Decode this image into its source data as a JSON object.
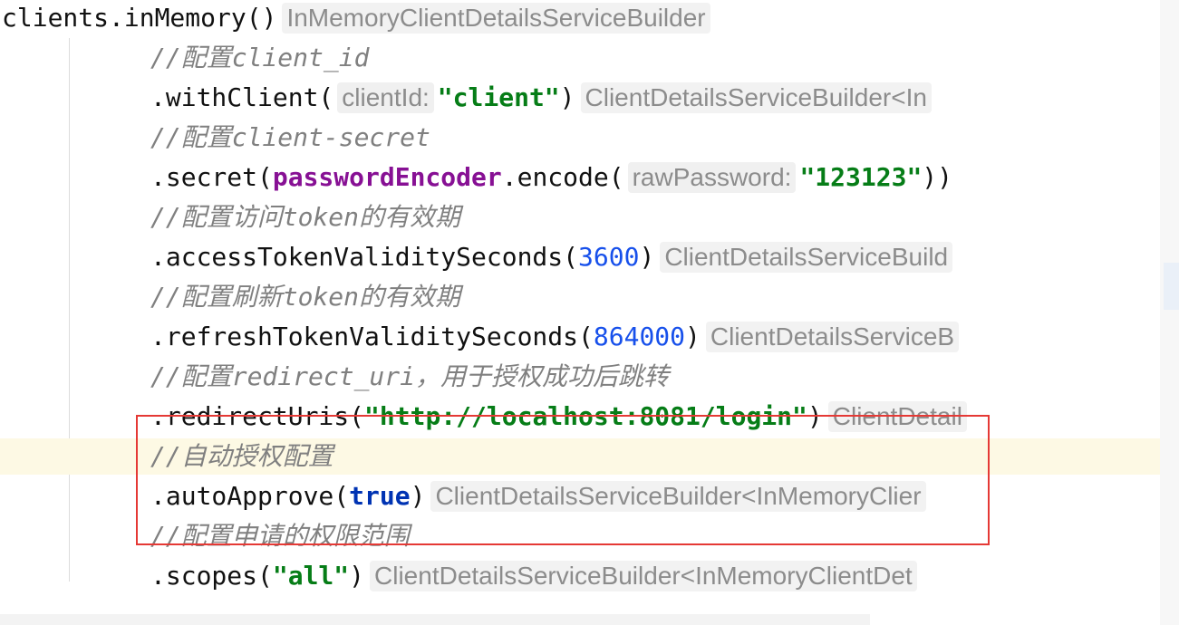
{
  "lines": [
    {
      "code": "clients.inMemory()",
      "hint": "InMemoryClientDetailsServiceBuilder"
    },
    {
      "comment": "//配置client_id"
    },
    {
      "pre": ".withClient(",
      "param": "clientId:",
      "arg": "\"client\"",
      "post": ")",
      "hint": "ClientDetailsServiceBuilder<In"
    },
    {
      "comment": "//配置client-secret"
    },
    {
      "pre": ".secret(",
      "field": "passwordEncoder",
      "mid": ".encode(",
      "param": "rawPassword:",
      "arg": "\"123123\"",
      "post": "))"
    },
    {
      "comment": "//配置访问token的有效期"
    },
    {
      "pre": ".accessTokenValiditySeconds(",
      "arg": "3600",
      "post": ")",
      "hint": "ClientDetailsServiceBuild"
    },
    {
      "comment": "//配置刷新token的有效期"
    },
    {
      "pre": ".refreshTokenValiditySeconds(",
      "arg": "864000",
      "post": ")",
      "hint": "ClientDetailsServiceB"
    },
    {
      "comment": "//配置redirect_uri，用于授权成功后跳转"
    },
    {
      "pre": ".redirectUris(",
      "arg": "\"http://localhost:8081/login\"",
      "post": ")",
      "hint": "ClientDetail"
    },
    {
      "comment": "//自动授权配置"
    },
    {
      "pre": ".autoApprove(",
      "arg": "true",
      "post": ")",
      "hint": "ClientDetailsServiceBuilder<InMemoryClier"
    },
    {
      "comment": "//配置申请的权限范围"
    },
    {
      "pre": ".scopes(",
      "arg": "\"all\"",
      "post": ")",
      "hint": "ClientDetailsServiceBuilder<InMemoryClientDet"
    }
  ],
  "colors": {
    "string": "#067d17",
    "number": "#1750eb",
    "keyword": "#0033b3",
    "field": "#871094",
    "comment": "#808080",
    "hint": "#8c8c8c",
    "highlight_box": "#e53935",
    "current_line": "#fdf9e4"
  }
}
